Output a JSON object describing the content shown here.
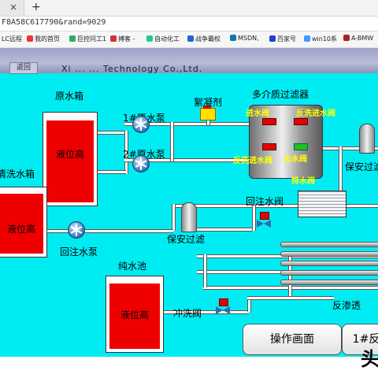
{
  "browser": {
    "tab_close": "×",
    "tab_new": "+",
    "address": "F8A58C617790&rand=9029",
    "bookmarks": [
      "LC远程",
      "我的首页",
      "巨控问工1",
      "搏客 -",
      "自动化工",
      "战争霸权",
      "MSDN,",
      "百家号",
      "win10系",
      "A-BMW"
    ]
  },
  "header": {
    "title": "Xi ... ... Technology Co.,Ltd.",
    "left_button": "返回"
  },
  "labels": {
    "raw_tank_title": "原水箱",
    "wash_tank_title": "清洗水箱",
    "pure_tank_title": "纯水池",
    "pump1": "1#原水泵",
    "pump2": "2#原水泵",
    "flocculant": "絮凝剂",
    "mmf": "多介质过滤器",
    "return_valve": "回注水阀",
    "return_pump": "回注水泵",
    "security_filter1": "保安过滤",
    "security_filter2": "保安过滤",
    "flush_valve": "冲洗阀",
    "ro": "反渗透"
  },
  "mmf_valves": {
    "in": "进水阀",
    "backwash_in": "反洗进水阀",
    "backwash_out": "反洗进水阀",
    "out": "出水阀",
    "drain": "排水阀"
  },
  "tanks": {
    "raw": {
      "level_text": "液位高",
      "level": 0.95
    },
    "wash": {
      "level_text": "液位高",
      "level": 0.95
    },
    "pure": {
      "level_text": "液位高",
      "level": 0.95
    }
  },
  "buttons": {
    "operation": "操作画面",
    "next": "1#反"
  },
  "corner_text": "头",
  "colors": {
    "background": "#00ecf3",
    "alarm": "#ee0000",
    "valve_label": "#ffff00"
  }
}
